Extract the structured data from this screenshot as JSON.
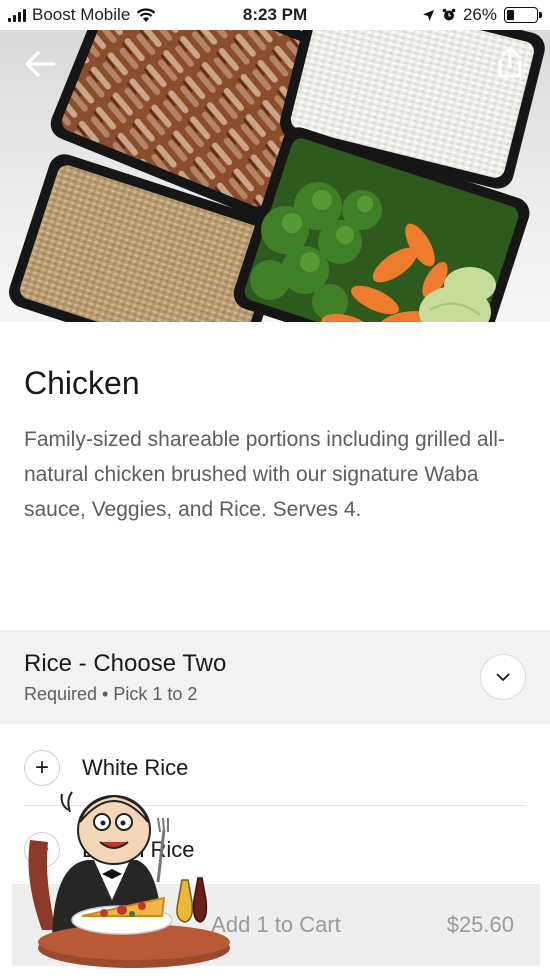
{
  "status_bar": {
    "carrier": "Boost Mobile",
    "time": "8:23 PM",
    "battery": "26%",
    "battery_level": 0.26
  },
  "hero": {
    "back_icon": "arrow-left-icon",
    "share_icon": "share-icon"
  },
  "product": {
    "title": "Chicken",
    "description": "Family-sized shareable portions including grilled all-natural chicken brushed with our signature Waba sauce, Veggies, and Rice. Serves 4."
  },
  "option_group": {
    "title": "Rice - Choose Two",
    "subtitle": "Required • Pick 1 to 2",
    "toggle_icon": "chevron-down-icon",
    "options": [
      {
        "label": "White Rice",
        "icon": "plus-icon"
      },
      {
        "label": "Brown Rice",
        "icon": "plus-icon",
        "visible_label": "wn Rice"
      }
    ]
  },
  "cart": {
    "label": "Add 1 to Cart",
    "visible_label": "d 1 to Cart",
    "price": "$25.60"
  },
  "colors": {
    "background": "#ffffff",
    "group_header_bg": "#f2f2f2",
    "cart_bar_bg": "#eeeeee",
    "muted_text": "#5e5e5e"
  }
}
